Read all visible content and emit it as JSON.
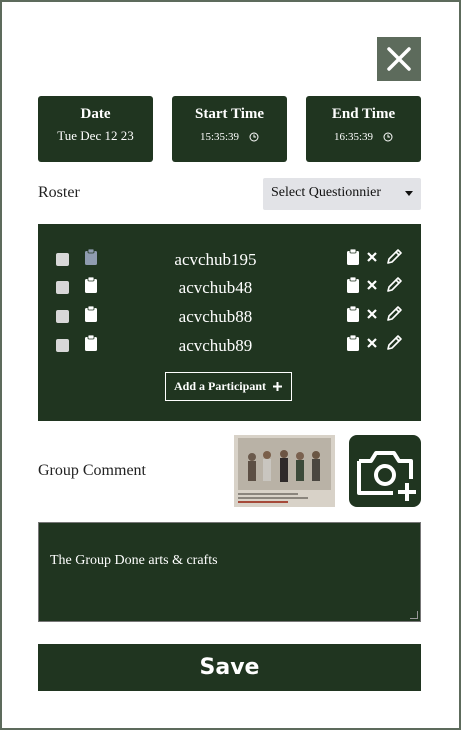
{
  "header": {
    "close_icon": "close-icon"
  },
  "date_card": {
    "label": "Date",
    "value": "Tue Dec 12 23"
  },
  "start_card": {
    "label": "Start Time",
    "value": "15:35:39",
    "icon": "clock-icon"
  },
  "end_card": {
    "label": "End Time",
    "value": "16:35:39",
    "icon": "clock-icon"
  },
  "roster": {
    "label": "Roster",
    "select": {
      "selected": "Select Questionnier"
    },
    "participants": [
      {
        "name": "acvchub195"
      },
      {
        "name": "acvchub48"
      },
      {
        "name": "acvchub88"
      },
      {
        "name": "acvchub89"
      }
    ],
    "add_label": "Add a Participant"
  },
  "group_comment": {
    "label": "Group Comment",
    "text": "The Group Done arts & crafts"
  },
  "save_label": "Save",
  "colors": {
    "dark_green": "#203520",
    "gray_green": "#5d6b5c",
    "select_bg": "#e2e3e7"
  }
}
